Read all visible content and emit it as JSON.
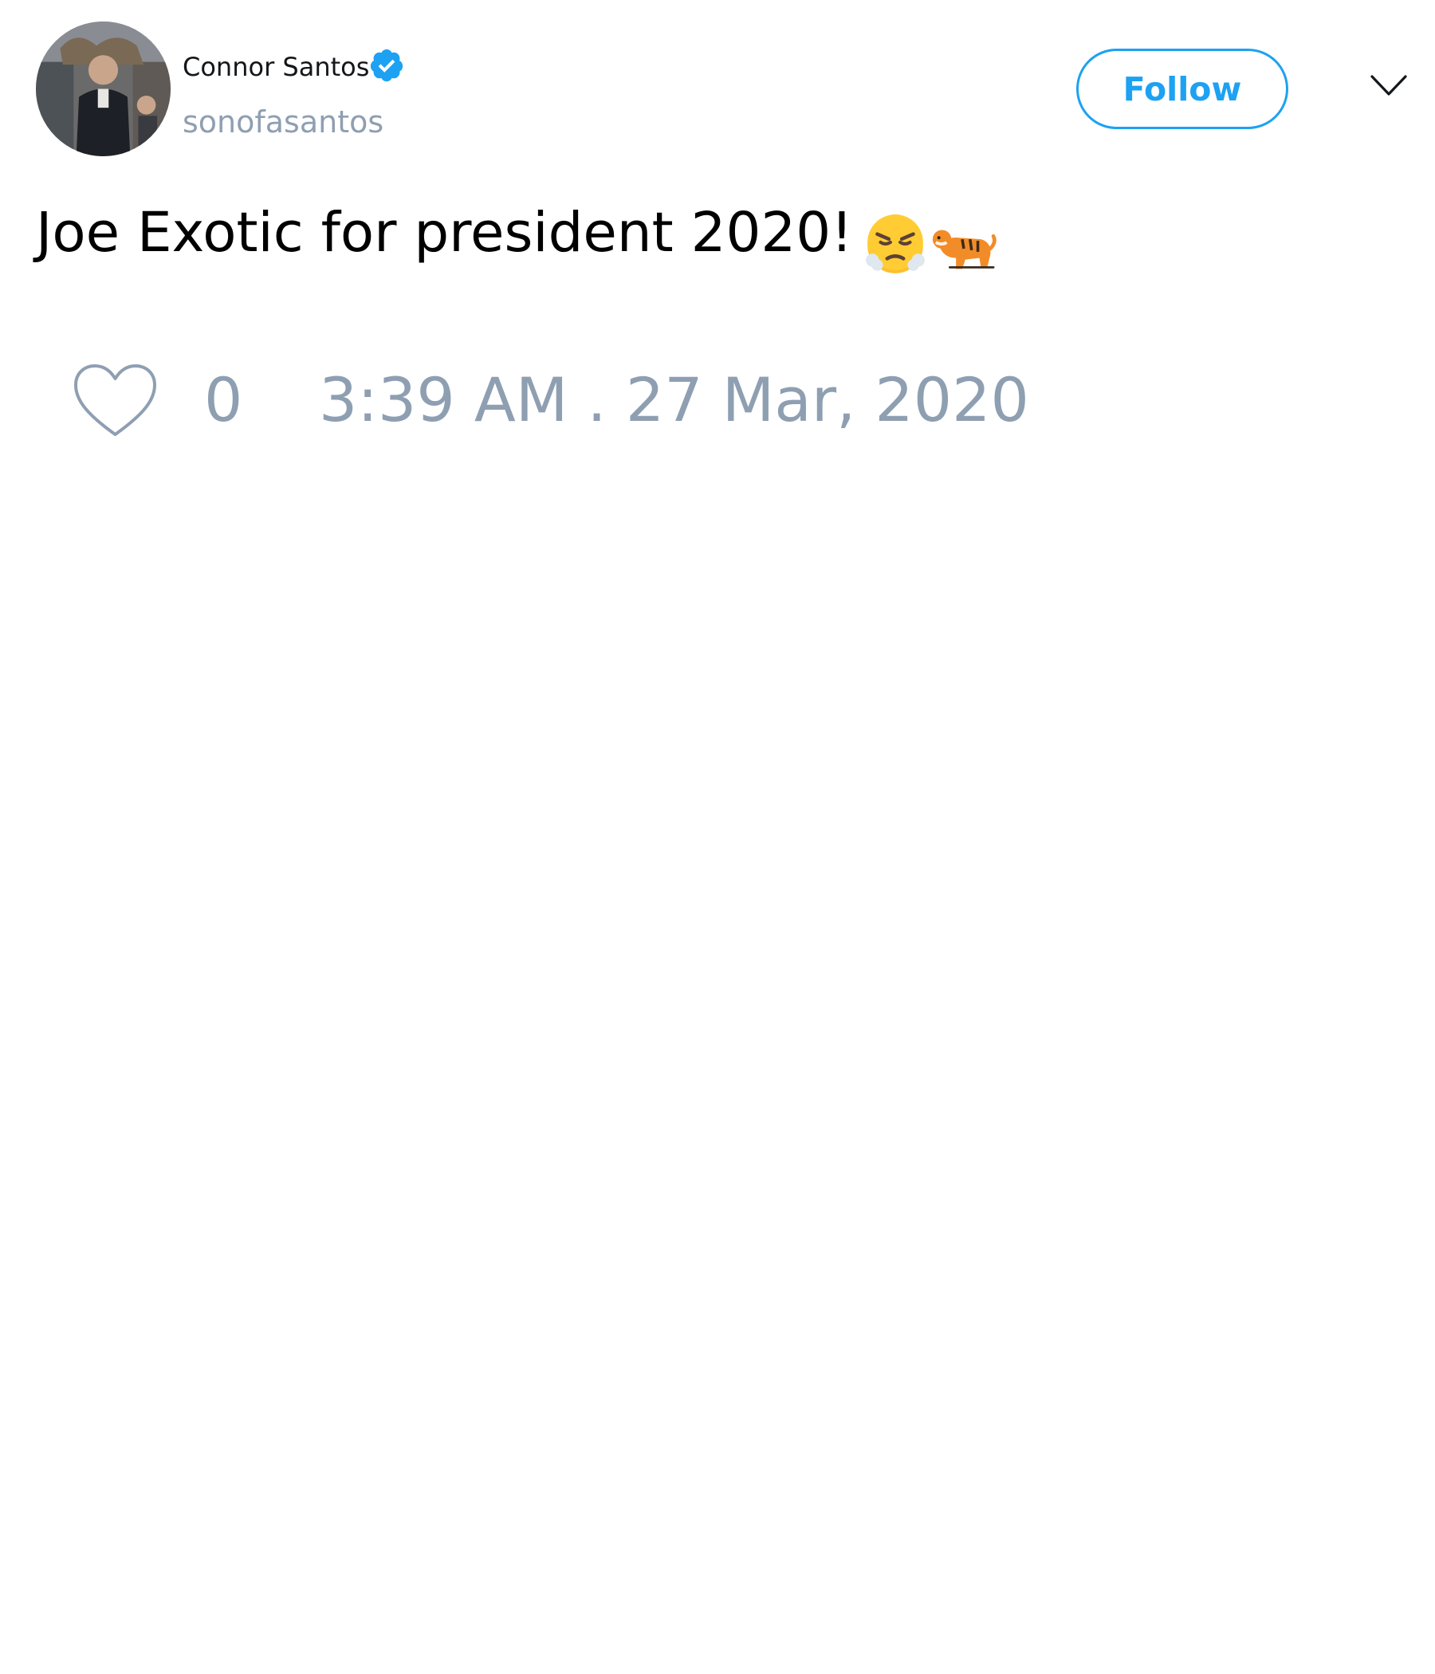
{
  "author": {
    "display_name": "Connor Santos",
    "handle": "sonofasantos",
    "verified_icon": "verified-badge-icon",
    "avatar": "avatar-photo"
  },
  "actions": {
    "follow_label": "Follow",
    "menu_icon": "chevron-down-icon"
  },
  "tweet": {
    "text": "Joe Exotic for president 2020!",
    "emojis": [
      "face-with-steam-from-nose-icon",
      "tiger-icon"
    ]
  },
  "footer": {
    "like_icon": "heart-icon",
    "like_count": "0",
    "timestamp": "3:39 AM . 27 Mar, 2020"
  },
  "colors": {
    "accent": "#1da1f2",
    "muted": "#8f9fb2",
    "text": "#000000"
  }
}
